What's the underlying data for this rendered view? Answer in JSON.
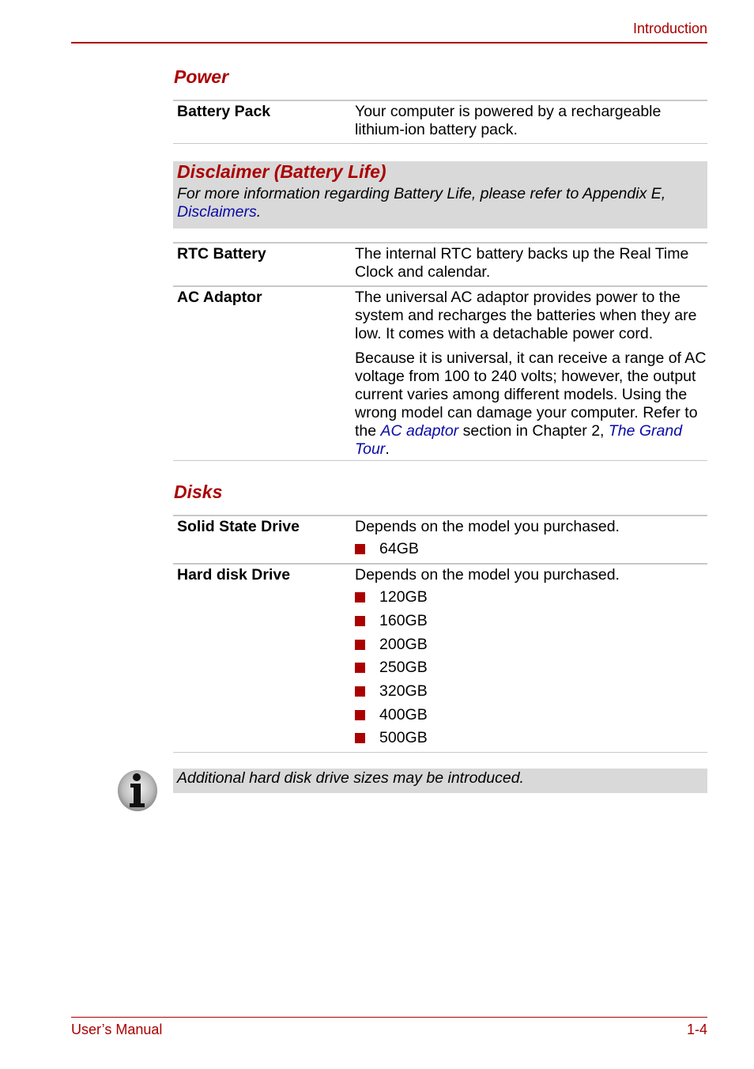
{
  "header": {
    "chapter": "Introduction"
  },
  "footer": {
    "manual": "User’s Manual",
    "page": "1-4"
  },
  "power": {
    "title": "Power",
    "battery_pack": {
      "term": "Battery Pack",
      "desc": "Your computer is powered by a rechargeable lithium-ion battery pack."
    },
    "disclaimer": {
      "title": "Disclaimer (Battery Life)",
      "body": "For more information regarding Battery Life, please refer to Appendix E, ",
      "link": "Disclaimers",
      "tail": "."
    },
    "rtc_battery": {
      "term": "RTC Battery",
      "desc": "The internal RTC battery backs up the Real Time Clock and calendar."
    },
    "ac_adaptor": {
      "term": "AC Adaptor",
      "desc1": "The universal AC adaptor provides power to the system and recharges the batteries when they are low. It comes with a detachable power cord.",
      "desc2_a": "Because it is universal, it can receive a range of AC voltage from 100 to 240 volts; however, the output current varies among different models. Using the wrong model can damage your computer. Refer to the ",
      "desc2_link1": "AC adaptor",
      "desc2_b": " section in Chapter 2, ",
      "desc2_link2": "The Grand Tour",
      "desc2_c": "."
    }
  },
  "disks": {
    "title": "Disks",
    "ssd": {
      "term": "Solid State Drive",
      "desc": "Depends on the model you purchased.",
      "options": [
        "64GB"
      ]
    },
    "hdd": {
      "term": "Hard disk Drive",
      "desc": "Depends on the model you purchased.",
      "options": [
        "120GB",
        "160GB",
        "200GB",
        "250GB",
        "320GB",
        "400GB",
        "500GB"
      ]
    },
    "note": {
      "icon": "info-icon",
      "text": "Additional hard disk drive sizes may be introduced."
    }
  },
  "colors": {
    "accent": "#aa0000",
    "link": "#0a0aa8",
    "note_bg": "#d9d9d9",
    "rule": "#c8c8c8"
  }
}
